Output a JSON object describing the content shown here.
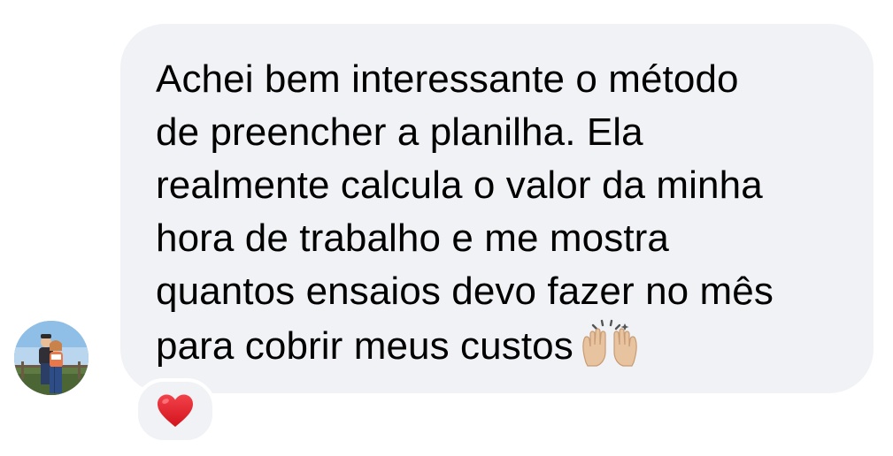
{
  "message": {
    "lines": [
      "Achei bem interessante o método",
      "de preencher a planilha. Ela",
      "realmente calcula o valor da minha",
      "hora de trabalho e me mostra",
      "quantos ensaios devo fazer no mês",
      "para cobrir meus custos"
    ],
    "trailing_icon": "raising-hands-emoji",
    "bubble_color": "#f1f2f5",
    "text_color": "#000000"
  },
  "reaction": {
    "icon": "red-heart-emoji",
    "color": "#e31b23"
  },
  "sender": {
    "avatar_icon": "profile-photo"
  }
}
